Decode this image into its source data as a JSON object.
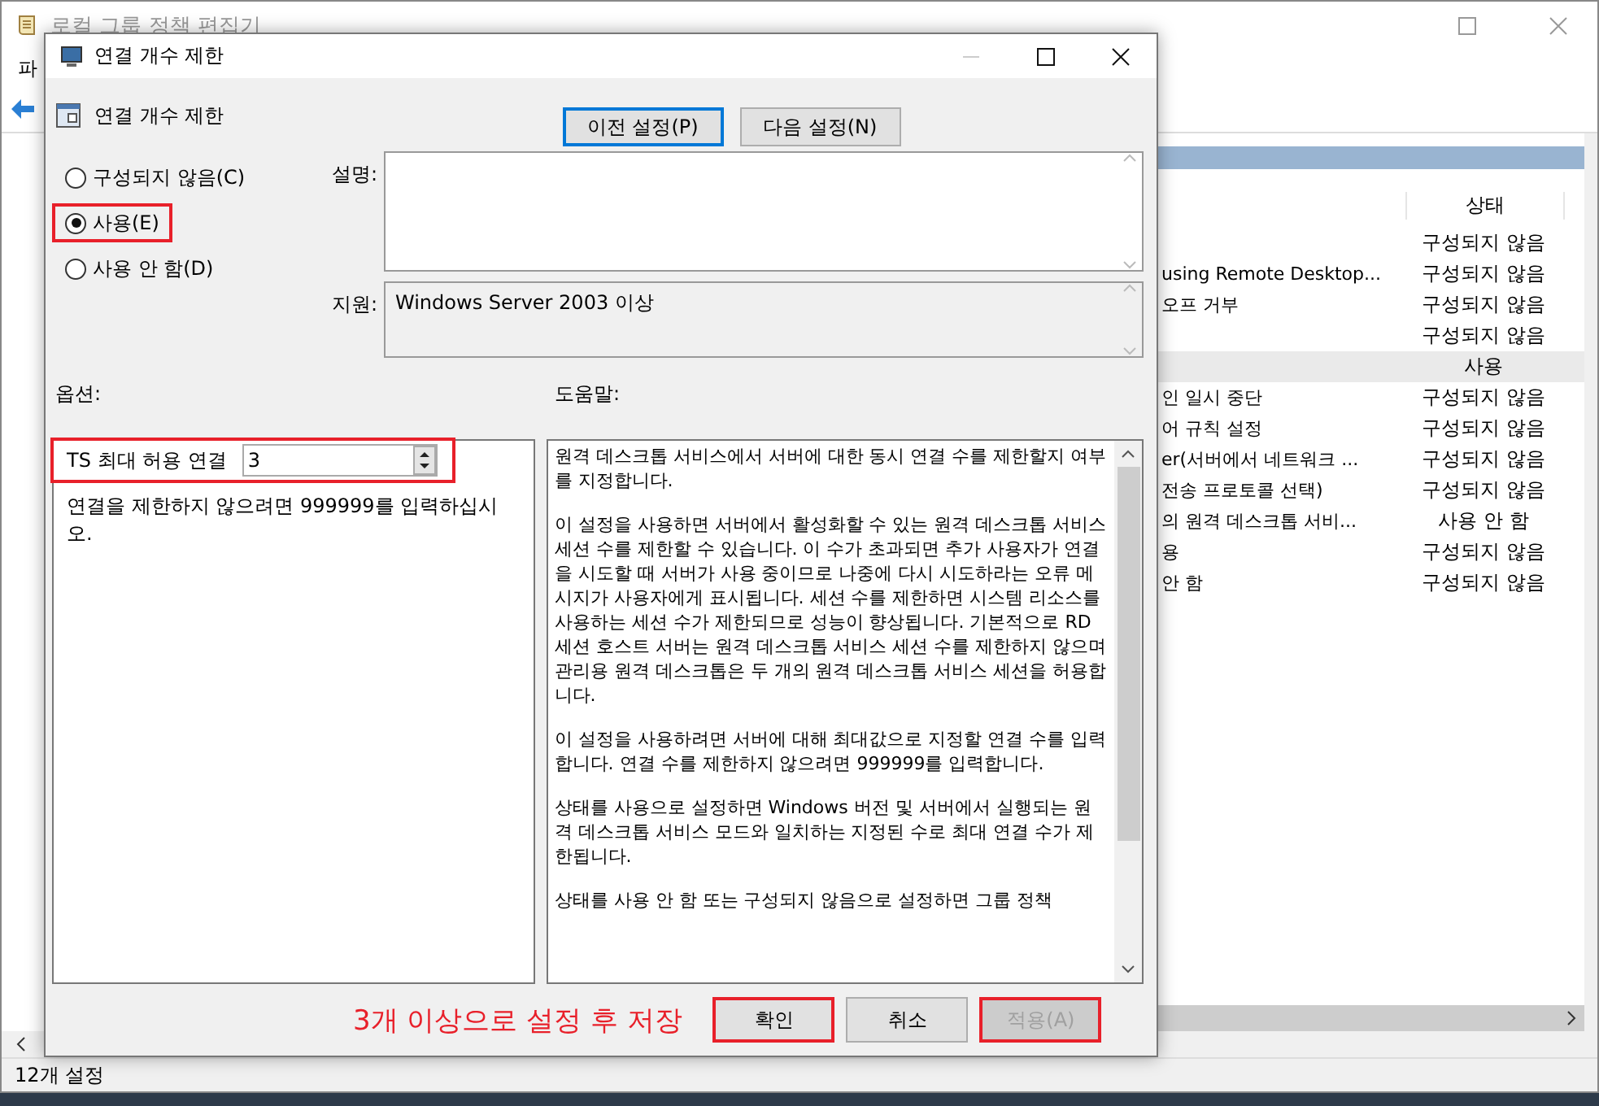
{
  "main_window": {
    "title": "로컬 그룹 정책 편집기",
    "menu": [
      "파"
    ],
    "list": {
      "columns": [
        "상태"
      ],
      "rows": [
        {
          "state": "구성되지 않음",
          "selected": false
        },
        {
          "name": "using Remote Desktop...",
          "state": "구성되지 않음",
          "selected": false
        },
        {
          "name": "오프 거부",
          "state": "구성되지 않음",
          "selected": false
        },
        {
          "state": "구성되지 않음",
          "selected": false
        },
        {
          "state": "사용",
          "selected": true
        },
        {
          "name": "인 일시 중단",
          "state": "구성되지 않음",
          "selected": false
        },
        {
          "name": "어 규칙 설정",
          "state": "구성되지 않음",
          "selected": false
        },
        {
          "name": "er(서버에서 네트워크 ...",
          "state": "구성되지 않음",
          "selected": false
        },
        {
          "name": "전송 프로토콜 선택)",
          "state": "구성되지 않음",
          "selected": false
        },
        {
          "name": "의 원격 데스크톱 서비...",
          "state": "사용 안 함",
          "selected": false
        },
        {
          "name": "용",
          "state": "구성되지 않음",
          "selected": false
        },
        {
          "name": "안 함",
          "state": "구성되지 않음",
          "selected": false
        }
      ]
    },
    "status_bar": "12개 설정"
  },
  "dialog": {
    "title": "연결 개수 제한",
    "heading": "연결 개수 제한",
    "nav_buttons": [
      {
        "label": "이전 설정(P)",
        "focused": true
      },
      {
        "label": "다음 설정(N)",
        "focused": false
      }
    ],
    "radios": [
      {
        "label": "구성되지 않음(C)",
        "selected": false,
        "highlighted": false
      },
      {
        "label": "사용(E)",
        "selected": true,
        "highlighted": true
      },
      {
        "label": "사용 안 함(D)",
        "selected": false,
        "highlighted": false
      }
    ],
    "comment_label": "설명:",
    "supported_label": "지원:",
    "supported": "Windows Server 2003 이상",
    "options_label": "옵션:",
    "help_label": "도움말:",
    "option": {
      "label": "TS 최대 허용 연결",
      "value": "3",
      "highlighted": true
    },
    "option_note": "연결을 제한하지 않으려면 999999를 입력하십시오.",
    "help": [
      "원격 데스크톱 서비스에서 서버에 대한 동시 연결 수를 제한할지 여부를 지정합니다.",
      "이 설정을 사용하면 서버에서 활성화할 수 있는 원격 데스크톱 서비스 세션 수를 제한할 수 있습니다. 이 수가 초과되면 추가 사용자가 연결을 시도할 때 서버가 사용 중이므로 나중에 다시 시도하라는 오류 메시지가 사용자에게 표시됩니다. 세션 수를 제한하면 시스템 리소스를 사용하는 세션 수가 제한되므로 성능이 향상됩니다. 기본적으로 RD 세션 호스트 서버는 원격 데스크톱 서비스 세션 수를 제한하지 않으며 관리용 원격 데스크톱은 두 개의 원격 데스크톱 서비스 세션을 허용합니다.",
      "이 설정을 사용하려면 서버에 대해 최대값으로 지정할 연결 수를 입력합니다. 연결 수를 제한하지 않으려면 999999를 입력합니다.",
      "상태를 사용으로 설정하면 Windows 버전 및 서버에서 실행되는 원격 데스크톱 서비스 모드와 일치하는 지정된 수로 최대 연결 수가 제한됩니다.",
      "상태를 사용 안 함 또는 구성되지 않음으로 설정하면 그룹 정책"
    ],
    "note": "3개 이상으로 설정 후 저장",
    "buttons": [
      {
        "label": "확인",
        "disabled": false,
        "highlighted": true
      },
      {
        "label": "취소",
        "disabled": false,
        "highlighted": false
      },
      {
        "label": "적용(A)",
        "disabled": true,
        "highlighted": true
      }
    ]
  }
}
